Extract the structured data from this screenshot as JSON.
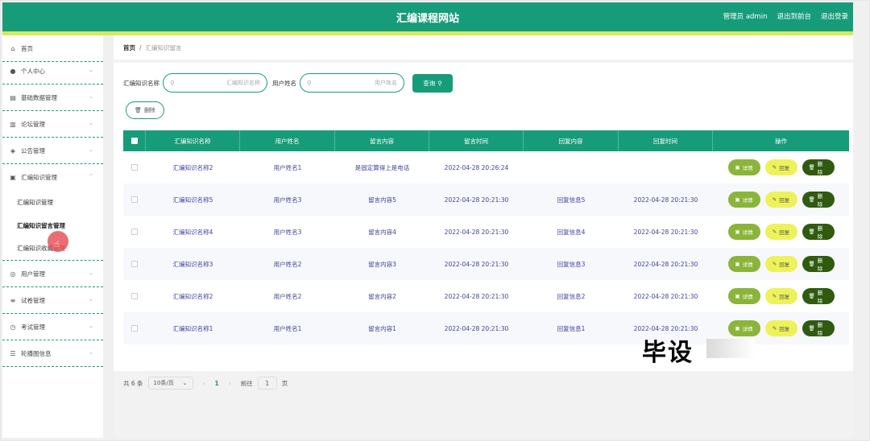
{
  "header": {
    "title": "汇编课程网站",
    "user": "管理员 admin",
    "back_link": "退出到前台",
    "logout_link": "退出登录"
  },
  "sidebar": {
    "items": [
      {
        "label": "首页",
        "icon": "home-icon"
      },
      {
        "label": "个人中心",
        "icon": "user-icon"
      },
      {
        "label": "基础数据管理",
        "icon": "clipboard-icon"
      },
      {
        "label": "论坛管理",
        "icon": "document-icon"
      },
      {
        "label": "公告管理",
        "icon": "megaphone-icon"
      },
      {
        "label": "汇编知识管理",
        "icon": "briefcase-icon"
      },
      {
        "label": "用户管理",
        "icon": "globe-icon"
      },
      {
        "label": "试卷管理",
        "icon": "list-icon"
      },
      {
        "label": "考试管理",
        "icon": "clock-icon"
      },
      {
        "label": "轮播图信息",
        "icon": "sliders-icon"
      }
    ],
    "subitems": [
      {
        "label": "汇编知识管理"
      },
      {
        "label": "汇编知识留言管理"
      },
      {
        "label": "汇编知识收藏管理"
      }
    ]
  },
  "breadcrumb": {
    "home": "首页",
    "separator": "/",
    "current": "汇编知识留言"
  },
  "search": {
    "field1_label": "汇编知识名称",
    "field1_placeholder": "汇编知识名称",
    "field2_label": "用户姓名",
    "field2_placeholder": "用户姓名",
    "query_label": "查询"
  },
  "toolbar": {
    "delete_label": "删除"
  },
  "table": {
    "columns": [
      "汇编知识名称",
      "用户姓名",
      "留言内容",
      "留言时间",
      "回复内容",
      "回复时间",
      "操作"
    ],
    "rows": [
      {
        "name": "汇编知识名称2",
        "user": "用户姓名1",
        "message": "是固定算得上是电话",
        "msg_time": "2022-04-28 20:26:24",
        "reply": "",
        "reply_time": ""
      },
      {
        "name": "汇编知识名称5",
        "user": "用户姓名3",
        "message": "留言内容5",
        "msg_time": "2022-04-28 20:21:30",
        "reply": "回复信息5",
        "reply_time": "2022-04-28 20:21:30"
      },
      {
        "name": "汇编知识名称4",
        "user": "用户姓名3",
        "message": "留言内容4",
        "msg_time": "2022-04-28 20:21:30",
        "reply": "回复信息4",
        "reply_time": "2022-04-28 20:21:30"
      },
      {
        "name": "汇编知识名称3",
        "user": "用户姓名2",
        "message": "留言内容3",
        "msg_time": "2022-04-28 20:21:30",
        "reply": "回复信息3",
        "reply_time": "2022-04-28 20:21:30"
      },
      {
        "name": "汇编知识名称2",
        "user": "用户姓名2",
        "message": "留言内容2",
        "msg_time": "2022-04-28 20:21:30",
        "reply": "回复信息2",
        "reply_time": "2022-04-28 20:21:30"
      },
      {
        "name": "汇编知识名称1",
        "user": "用户姓名1",
        "message": "留言内容1",
        "msg_time": "2022-04-28 20:21:30",
        "reply": "回复信息1",
        "reply_time": "2022-04-28 20:21:30"
      }
    ],
    "actions": {
      "detail": "详情",
      "reply": "回复",
      "delete": "删除"
    }
  },
  "pager": {
    "total": "共 6 条",
    "page_size": "10条/页",
    "current_page": "1",
    "goto_label": "前往",
    "goto_value": "1",
    "page_suffix": "页"
  },
  "watermark": "毕设",
  "colors": {
    "primary": "#179c7a",
    "accent_line": "#d8e85b",
    "detail_btn": "#8ab53a",
    "reply_btn": "#eef25a",
    "delete_btn": "#2f5a0f"
  }
}
